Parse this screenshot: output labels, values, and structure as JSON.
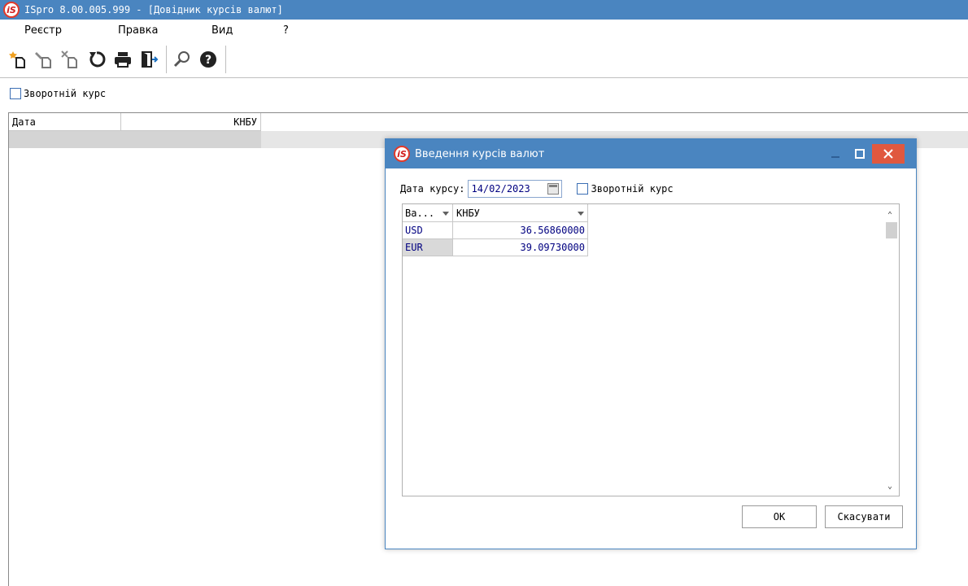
{
  "window": {
    "logo_text": "iS",
    "title": "ISpro 8.00.005.999 - [Довідник курсів валют]"
  },
  "menu": {
    "items": [
      "Реєстр",
      "Правка",
      "Вид",
      "?"
    ]
  },
  "toolbar": {
    "icons": [
      "new-icon",
      "edit-icon",
      "delete-icon",
      "refresh-icon",
      "print-icon",
      "exit-icon",
      "search-icon",
      "help-icon"
    ]
  },
  "main": {
    "reverse_rate_label": "Зворотній курс",
    "columns": [
      "Дата",
      "КНБУ"
    ]
  },
  "dialog": {
    "logo_text": "iS",
    "title": "Введення курсів валют",
    "date_label": "Дата курсу:",
    "date_value": "14/02/2023",
    "reverse_rate_label": "Зворотній курс",
    "columns": [
      "Ва...",
      "КНБУ"
    ],
    "rows": [
      {
        "currency": "USD",
        "rate": "36.56860000"
      },
      {
        "currency": "EUR",
        "rate": "39.09730000"
      }
    ],
    "ok_label": "ОК",
    "cancel_label": "Скасувати"
  },
  "colors": {
    "titlebar": "#4a85c0",
    "close_button": "#e0583f",
    "value_text": "#000080"
  }
}
